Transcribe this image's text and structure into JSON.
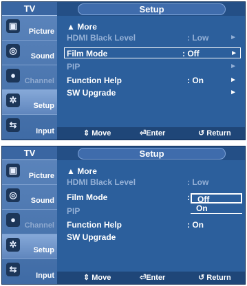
{
  "panels": [
    {
      "tv_header": "TV",
      "title": "Setup",
      "sidebar": [
        {
          "label": "Picture",
          "icon": "picture-icon"
        },
        {
          "label": "Sound",
          "icon": "sound-icon"
        },
        {
          "label": "Channel",
          "icon": "channel-icon"
        },
        {
          "label": "Setup",
          "icon": "setup-icon"
        },
        {
          "label": "Input",
          "icon": "input-icon"
        }
      ],
      "rows": [
        {
          "label": "▲ More",
          "value": "",
          "arrow": ""
        },
        {
          "label": "HDMI Black Level",
          "value": ": Low",
          "arrow": "►"
        },
        {
          "label": "Film Mode",
          "value": ": Off",
          "arrow": "►"
        },
        {
          "label": "PIP",
          "value": "",
          "arrow": "►"
        },
        {
          "label": "Function Help",
          "value": ": On",
          "arrow": "►"
        },
        {
          "label": "SW Upgrade",
          "value": "",
          "arrow": "►"
        }
      ],
      "hints": {
        "move": "⇕ Move",
        "enter": "⏎Enter",
        "return": "↺ Return"
      }
    },
    {
      "tv_header": "TV",
      "title": "Setup",
      "sidebar": [
        {
          "label": "Picture",
          "icon": "picture-icon"
        },
        {
          "label": "Sound",
          "icon": "sound-icon"
        },
        {
          "label": "Channel",
          "icon": "channel-icon"
        },
        {
          "label": "Setup",
          "icon": "setup-icon"
        },
        {
          "label": "Input",
          "icon": "input-icon"
        }
      ],
      "rows": [
        {
          "label": "▲ More",
          "value": ""
        },
        {
          "label": "HDMI Black Level",
          "value": ": Low"
        },
        {
          "label": "Film Mode",
          "value": ":"
        },
        {
          "label": "PIP",
          "value": ""
        },
        {
          "label": "Function Help",
          "value": ": On"
        },
        {
          "label": "SW Upgrade",
          "value": ""
        }
      ],
      "dropdown": {
        "options": [
          "Off",
          "On"
        ],
        "selected": "Off"
      },
      "hints": {
        "move": "⇕ Move",
        "enter": "⏎Enter",
        "return": "↺ Return"
      }
    }
  ]
}
